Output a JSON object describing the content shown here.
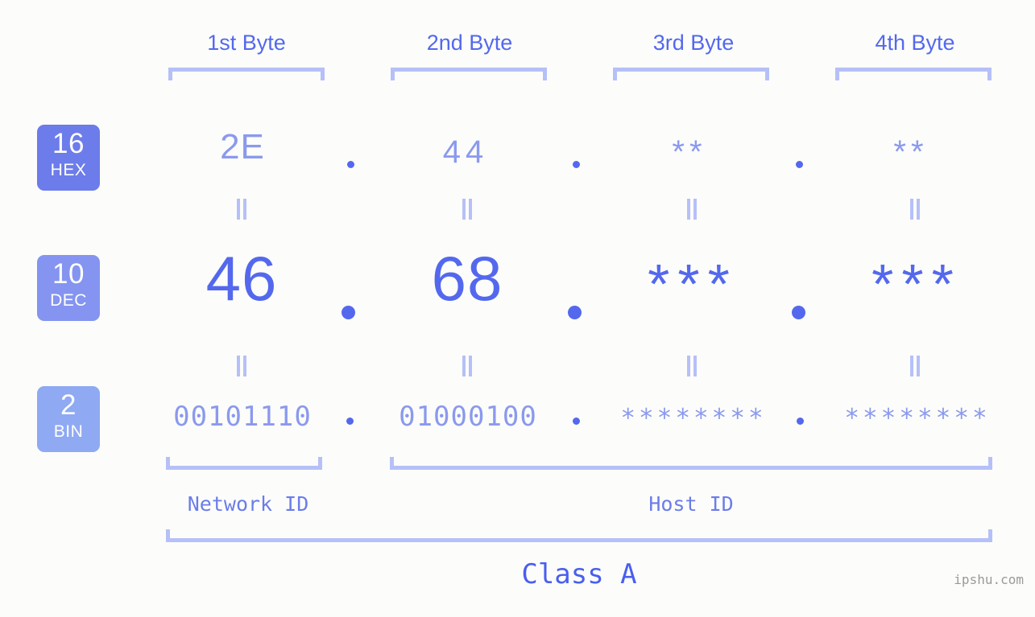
{
  "background_color": "#fcfdfa",
  "accent_colors": {
    "strong": "#5468ee",
    "medium": "#8b99ee",
    "light": "#b6c0f8",
    "badge_hex": "#6c7cea",
    "badge_dec": "#8494f0",
    "badge_bin": "#8fa9f3",
    "watermark": "#9a9a9a"
  },
  "byte_headers": [
    {
      "label": "1st Byte"
    },
    {
      "label": "2nd Byte"
    },
    {
      "label": "3rd Byte"
    },
    {
      "label": "4th Byte"
    }
  ],
  "radix_badges": [
    {
      "number": "16",
      "label": "HEX"
    },
    {
      "number": "10",
      "label": "DEC"
    },
    {
      "number": "2",
      "label": "BIN"
    }
  ],
  "rows": {
    "hex": {
      "radix": "16",
      "radix_label": "HEX",
      "values": [
        "2E",
        "44",
        "**",
        "**"
      ],
      "separator": "."
    },
    "dec": {
      "radix": "10",
      "radix_label": "DEC",
      "values": [
        "46",
        "68",
        "***",
        "***"
      ],
      "separator": "."
    },
    "bin": {
      "radix": "2",
      "radix_label": "BIN",
      "values": [
        "00101110",
        "01000100",
        "********",
        "********"
      ],
      "separator": "."
    }
  },
  "equality_marks": [
    "||",
    "||",
    "||",
    "||",
    "||",
    "||",
    "||",
    "||"
  ],
  "sections": [
    {
      "label": "Network ID"
    },
    {
      "label": "Host ID"
    }
  ],
  "class_label": "Class A",
  "watermark": "ipshu.com"
}
